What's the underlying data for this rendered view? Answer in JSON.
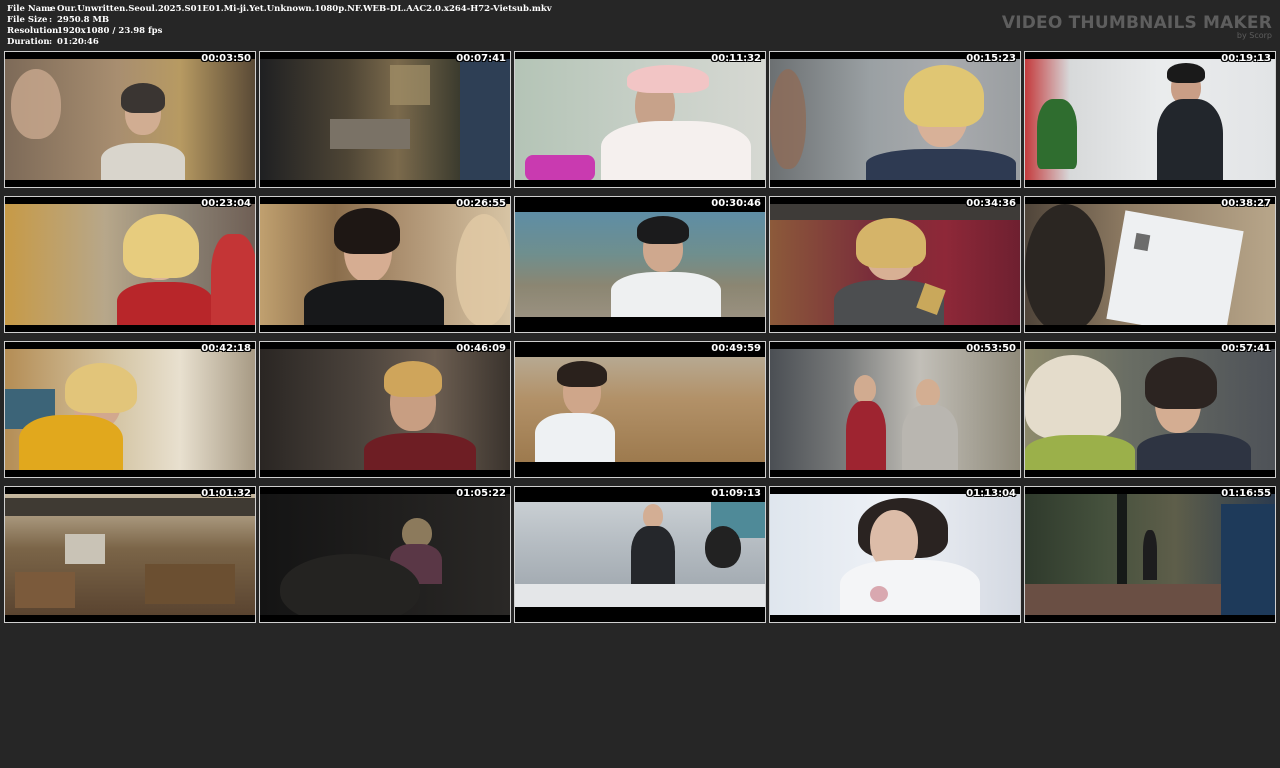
{
  "header": {
    "file_name_label": "File Name",
    "file_name": "Our.Unwritten.Seoul.2025.S01E01.Mi-ji.Yet.Unknown.1080p.NF.WEB-DL.AAC2.0.x264-H72-Vietsub.mkv",
    "file_size_label": "File Size",
    "file_size": "2950.8 MB",
    "resolution_label": "Resolution",
    "resolution": "1920x1080 / 23.98 fps",
    "duration_label": "Duration",
    "duration": "01:20:46",
    "separator": ":"
  },
  "brand": {
    "title": "VIDEO THUMBNAILS MAKER",
    "subtitle": "by Scorp"
  },
  "thumbnails": [
    {
      "time": "00:03:50"
    },
    {
      "time": "00:07:41"
    },
    {
      "time": "00:11:32"
    },
    {
      "time": "00:15:23"
    },
    {
      "time": "00:19:13"
    },
    {
      "time": "00:23:04"
    },
    {
      "time": "00:26:55"
    },
    {
      "time": "00:30:46"
    },
    {
      "time": "00:34:36"
    },
    {
      "time": "00:38:27"
    },
    {
      "time": "00:42:18"
    },
    {
      "time": "00:46:09"
    },
    {
      "time": "00:49:59"
    },
    {
      "time": "00:53:50"
    },
    {
      "time": "00:57:41"
    },
    {
      "time": "01:01:32"
    },
    {
      "time": "01:05:22"
    },
    {
      "time": "01:09:13"
    },
    {
      "time": "01:13:04"
    },
    {
      "time": "01:16:55"
    }
  ]
}
